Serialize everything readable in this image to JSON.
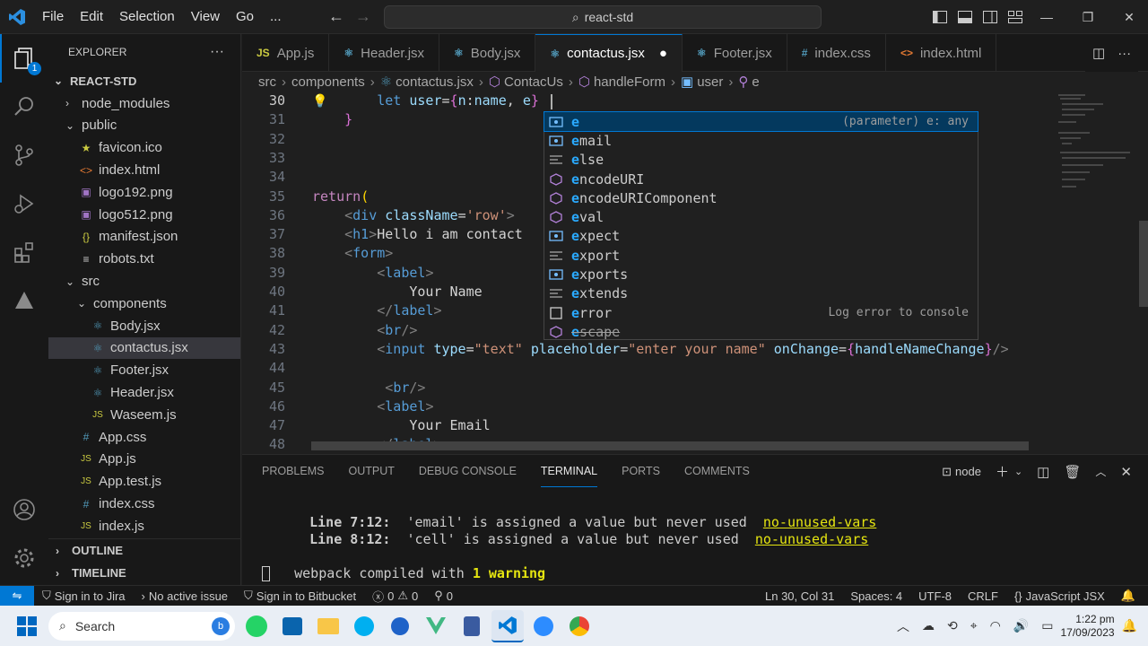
{
  "window": {
    "search_text": "react-std"
  },
  "menu": [
    "File",
    "Edit",
    "Selection",
    "View",
    "Go",
    "..."
  ],
  "explorer": {
    "header": "EXPLORER",
    "root": "REACT-STD",
    "tree": [
      {
        "label": "node_modules",
        "depth": 1,
        "type": "folder",
        "open": false
      },
      {
        "label": "public",
        "depth": 1,
        "type": "folder",
        "open": true
      },
      {
        "label": "favicon.ico",
        "depth": 2,
        "type": "ico"
      },
      {
        "label": "index.html",
        "depth": 2,
        "type": "html"
      },
      {
        "label": "logo192.png",
        "depth": 2,
        "type": "png"
      },
      {
        "label": "logo512.png",
        "depth": 2,
        "type": "png"
      },
      {
        "label": "manifest.json",
        "depth": 2,
        "type": "json"
      },
      {
        "label": "robots.txt",
        "depth": 2,
        "type": "txt"
      },
      {
        "label": "src",
        "depth": 1,
        "type": "folder",
        "open": true
      },
      {
        "label": "components",
        "depth": 2,
        "type": "folder",
        "open": true
      },
      {
        "label": "Body.jsx",
        "depth": 3,
        "type": "jsx"
      },
      {
        "label": "contactus.jsx",
        "depth": 3,
        "type": "jsx",
        "selected": true
      },
      {
        "label": "Footer.jsx",
        "depth": 3,
        "type": "jsx"
      },
      {
        "label": "Header.jsx",
        "depth": 3,
        "type": "jsx"
      },
      {
        "label": "Waseem.js",
        "depth": 3,
        "type": "js"
      },
      {
        "label": "App.css",
        "depth": 2,
        "type": "css"
      },
      {
        "label": "App.js",
        "depth": 2,
        "type": "js"
      },
      {
        "label": "App.test.js",
        "depth": 2,
        "type": "js"
      },
      {
        "label": "index.css",
        "depth": 2,
        "type": "css"
      },
      {
        "label": "index.js",
        "depth": 2,
        "type": "js"
      }
    ],
    "outline": "OUTLINE",
    "timeline": "TIMELINE"
  },
  "tabs": [
    {
      "label": "App.js",
      "icon": "JS",
      "color": "#cbcb41"
    },
    {
      "label": "Header.jsx",
      "icon": "⚛",
      "color": "#519aba"
    },
    {
      "label": "Body.jsx",
      "icon": "⚛",
      "color": "#519aba"
    },
    {
      "label": "contactus.jsx",
      "icon": "⚛",
      "color": "#519aba",
      "active": true,
      "dirty": "●"
    },
    {
      "label": "Footer.jsx",
      "icon": "⚛",
      "color": "#519aba"
    },
    {
      "label": "index.css",
      "icon": "#",
      "color": "#519aba"
    },
    {
      "label": "index.html",
      "icon": "<>",
      "color": "#e37933"
    }
  ],
  "breadcrumb": [
    "src",
    "components",
    "contactus.jsx",
    "ContacUs",
    "handleForm",
    "user",
    "e"
  ],
  "code": [
    {
      "n": "30",
      "html": "        <span class='kw'>let</span> <span class='var'>user</span><span class='txt'>=</span><span class='brk'>{</span><span class='var'>n</span><span class='txt'>:</span><span class='var'>name</span><span class='txt'>, </span><span class='var'>e</span><span class='brk'>}</span>"
    },
    {
      "n": "31",
      "html": "    <span class='brk'>}</span>"
    },
    {
      "n": "32",
      "html": ""
    },
    {
      "n": "33",
      "html": ""
    },
    {
      "n": "34",
      "html": ""
    },
    {
      "n": "35",
      "html": "<span class='kw2'>return</span><span class='brk2'>(</span>"
    },
    {
      "n": "36",
      "html": "    <span class='tag'>&lt;</span><span class='tagn'>div</span> <span class='attr'>className</span><span class='txt'>=</span><span class='str'>'row'</span><span class='tag'>&gt;</span>"
    },
    {
      "n": "37",
      "html": "    <span class='tag'>&lt;</span><span class='tagn'>h1</span><span class='tag'>&gt;</span><span class='txt'>Hello i am contact</span>"
    },
    {
      "n": "38",
      "html": "    <span class='tag'>&lt;</span><span class='tagn'>form</span><span class='tag'>&gt;</span>"
    },
    {
      "n": "39",
      "html": "        <span class='tag'>&lt;</span><span class='tagn'>label</span><span class='tag'>&gt;</span>"
    },
    {
      "n": "40",
      "html": "            <span class='txt'>Your Name</span>"
    },
    {
      "n": "41",
      "html": "        <span class='tag'>&lt;/</span><span class='tagn'>label</span><span class='tag'>&gt;</span>"
    },
    {
      "n": "42",
      "html": "        <span class='tag'>&lt;</span><span class='tagn'>br</span><span class='tag'>/&gt;</span>"
    },
    {
      "n": "43",
      "html": "        <span class='tag'>&lt;</span><span class='tagn'>input</span> <span class='attr'>type</span><span class='txt'>=</span><span class='str'>\"text\"</span> <span class='attr'>placeholder</span><span class='txt'>=</span><span class='str'>\"enter your name\"</span> <span class='attr'>onChange</span><span class='txt'>=</span><span class='brk'>{</span><span class='var'>handleNameChange</span><span class='brk'>}</span><span class='tag'>/&gt;</span>"
    },
    {
      "n": "44",
      "html": ""
    },
    {
      "n": "45",
      "html": "         <span class='tag'>&lt;</span><span class='tagn'>br</span><span class='tag'>/&gt;</span>"
    },
    {
      "n": "46",
      "html": "        <span class='tag'>&lt;</span><span class='tagn'>label</span><span class='tag'>&gt;</span>"
    },
    {
      "n": "47",
      "html": "            <span class='txt'>Your Email</span>"
    },
    {
      "n": "48",
      "html": "        <span class='tag'>&lt;/</span><span class='tagn'>label</span><span class='tag'>&gt;</span>"
    }
  ],
  "suggest": [
    {
      "label": "e",
      "icon": "var",
      "detail": "(parameter) e: any",
      "sel": true
    },
    {
      "label": "email",
      "icon": "var"
    },
    {
      "label": "else",
      "icon": "kw"
    },
    {
      "label": "encodeURI",
      "icon": "fn"
    },
    {
      "label": "encodeURIComponent",
      "icon": "fn"
    },
    {
      "label": "eval",
      "icon": "fn"
    },
    {
      "label": "expect",
      "icon": "var"
    },
    {
      "label": "export",
      "icon": "kw"
    },
    {
      "label": "exports",
      "icon": "var"
    },
    {
      "label": "extends",
      "icon": "kw"
    },
    {
      "label": "error",
      "icon": "snip",
      "detail": "Log error to console"
    },
    {
      "label": "escape",
      "icon": "fn"
    }
  ],
  "panel": {
    "tabs": [
      "PROBLEMS",
      "OUTPUT",
      "DEBUG CONSOLE",
      "TERMINAL",
      "PORTS",
      "COMMENTS"
    ],
    "active": "TERMINAL",
    "shell": "node",
    "warn1_loc": "Line 7:12:",
    "warn1_msg": "'email' is assigned a value but never used",
    "warn1_rule": "no-unused-vars",
    "warn2_loc": "Line 8:12:",
    "warn2_msg": "'cell' is assigned a value but never used",
    "warn2_rule": "no-unused-vars",
    "compiled": "webpack compiled with ",
    "warning": "1 warning"
  },
  "status": {
    "jira": "Sign in to Jira",
    "issue": "No active issue",
    "bitbucket": "Sign in to Bitbucket",
    "errors": "0",
    "warnings": "0",
    "ports": "0",
    "position": "Ln 30, Col 31",
    "spaces": "Spaces: 4",
    "encoding": "UTF-8",
    "eol": "CRLF",
    "lang": "JavaScript JSX"
  },
  "taskbar": {
    "search": "Search",
    "time": "1:22 pm",
    "date": "17/09/2023"
  }
}
